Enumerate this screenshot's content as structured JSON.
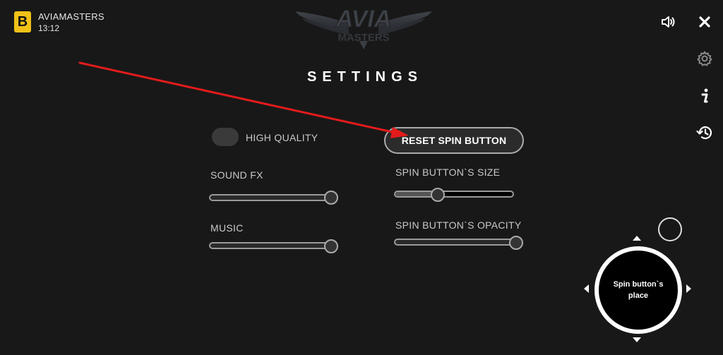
{
  "app": {
    "badge": "B",
    "name": "AVIAMASTERS",
    "time": "13:12"
  },
  "logo": {
    "line1": "AVIA",
    "line2": "MASTERS"
  },
  "icons": {
    "sound": "speaker-icon",
    "close": "close-icon",
    "settings": "gear-icon",
    "info": "info-icon",
    "history": "history-icon"
  },
  "settings": {
    "title": "SETTINGS",
    "high_quality_label": "HIGH QUALITY",
    "high_quality_on": false,
    "sound_fx_label": "SOUND FX",
    "sound_fx_level": 1.0,
    "music_label": "MUSIC",
    "music_level": 1.0,
    "reset_button_label": "RESET SPIN BUTTON",
    "spin_size_label": "SPIN BUTTON`S SIZE",
    "spin_size_level": 0.35,
    "spin_opacity_label": "SPIN BUTTON`S OPACITY",
    "spin_opacity_level": 1.0
  },
  "spin_place": {
    "line1": "Spin button`s",
    "line2": "place"
  },
  "annotation": {
    "arrow_color": "#e21b1b"
  },
  "colors": {
    "badge": "#f2c118",
    "background": "#181818"
  }
}
